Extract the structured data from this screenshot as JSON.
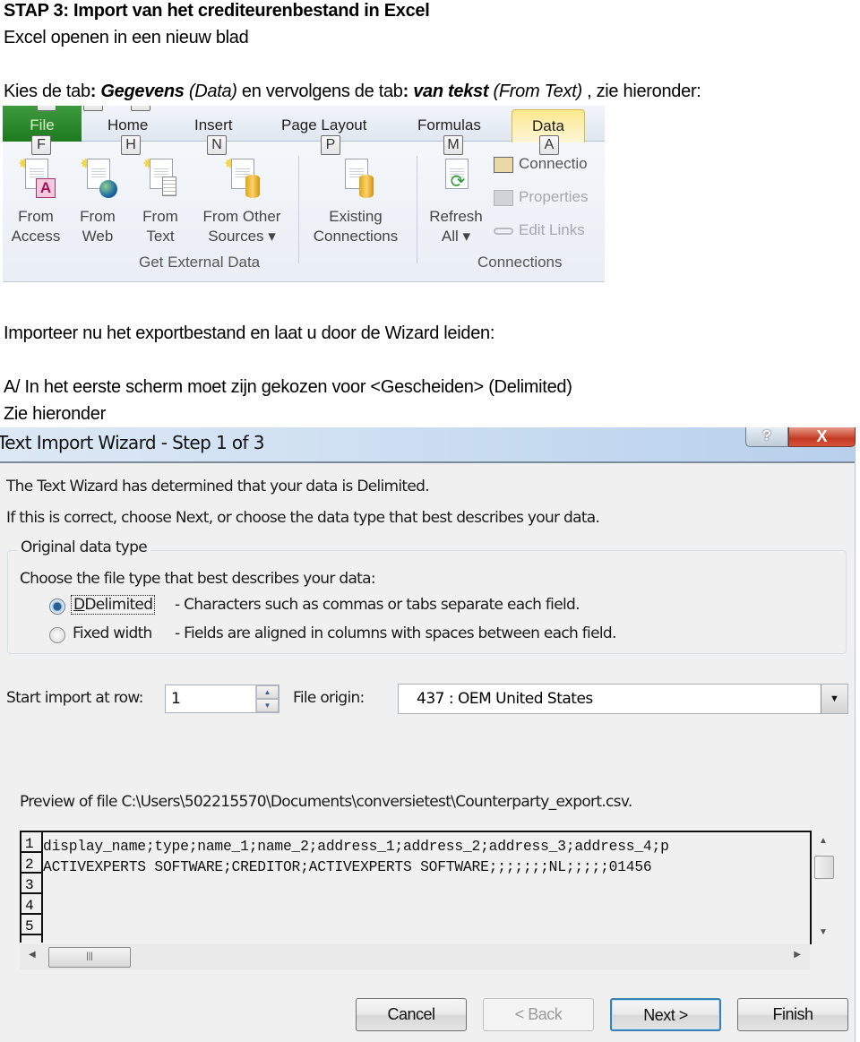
{
  "document": {
    "heading": "STAP 3: Import van het crediteurenbestand in Excel",
    "subheading": "Excel openen in een nieuw blad",
    "instruction1": {
      "prefix": "Kies de tab",
      "colon1": ": ",
      "tab_bold": "Gegevens",
      "tab_italic": " (Data)",
      "middle": " en vervolgens de tab",
      "colon2": ": ",
      "sub_bold": "van tekst",
      "sub_italic": " (From Text)",
      "suffix": " , zie hieronder:"
    },
    "instruction2": "Importeer nu het exportbestand  en laat u door de Wizard leiden:",
    "instruction3": "A/ In het eerste scherm moet zijn gekozen voor <Gescheiden> (Delimited)",
    "instruction4": "Zie hieronder"
  },
  "ribbon": {
    "tabs": [
      {
        "label": "File",
        "keytip": "F"
      },
      {
        "label": "Home",
        "keytip": "H"
      },
      {
        "label": "Insert",
        "keytip": "N"
      },
      {
        "label": "Page Layout",
        "keytip": "P"
      },
      {
        "label": "Formulas",
        "keytip": "M"
      },
      {
        "label": "Data",
        "keytip": "A"
      }
    ],
    "active_tab": "Data",
    "get_external_data": {
      "group_label": "Get External Data",
      "buttons": [
        {
          "line1": "From",
          "line2": "Access"
        },
        {
          "line1": "From",
          "line2": "Web"
        },
        {
          "line1": "From",
          "line2": "Text"
        },
        {
          "line1": "From Other",
          "line2": "Sources ▾"
        }
      ]
    },
    "existing_connections": {
      "line1": "Existing",
      "line2": "Connections"
    },
    "connections": {
      "group_label": "Connections",
      "refresh": {
        "line1": "Refresh",
        "line2": "All ▾"
      },
      "items": [
        "Connectio",
        "Properties",
        "Edit Links"
      ]
    }
  },
  "wizard": {
    "title": "Text Import Wizard - Step 1 of 3",
    "help_glyph": "?",
    "close_glyph": "X",
    "intro1": "The Text Wizard has determined that your data is Delimited.",
    "intro2": "If this is correct, choose Next, or choose the data type that best describes your data.",
    "group_label": "Original data type",
    "choose_label": "Choose the file type that best describes your data:",
    "options": [
      {
        "label": "Delimited",
        "description": "- Characters such as commas or tabs separate each field.",
        "selected": true
      },
      {
        "label": "Fixed width",
        "description": "- Fields are aligned in columns with spaces between each field.",
        "selected": false
      }
    ],
    "start_row_label": "Start import at row:",
    "start_row_value": "1",
    "file_origin_label": "File origin:",
    "file_origin_value": "437 : OEM United States",
    "preview_label": "Preview of file C:\\Users\\502215570\\Documents\\conversietest\\Counterparty_export.csv.",
    "preview_rows": [
      {
        "num": "1",
        "text": "display_name;type;name_1;name_2;address_1;address_2;address_3;address_4;p"
      },
      {
        "num": "2",
        "text": "ACTIVEXPERTS SOFTWARE;CREDITOR;ACTIVEXPERTS SOFTWARE;;;;;;;NL;;;;;01456"
      },
      {
        "num": "3",
        "text": ""
      },
      {
        "num": "4",
        "text": ""
      },
      {
        "num": "5",
        "text": ""
      }
    ],
    "buttons": {
      "cancel": "Cancel",
      "back": "< Back",
      "next": "Next >",
      "finish": "Finish"
    }
  }
}
